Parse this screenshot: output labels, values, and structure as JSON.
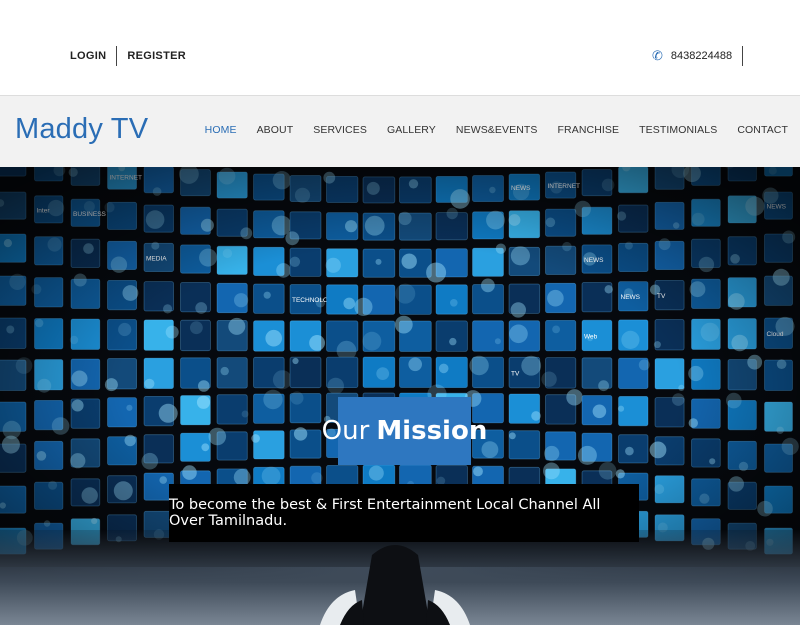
{
  "topbar": {
    "login": "LOGIN",
    "register": "REGISTER",
    "phone": "8438224488"
  },
  "navbar": {
    "brand": "Maddy TV",
    "items": [
      {
        "label": "HOME",
        "active": true
      },
      {
        "label": "ABOUT",
        "active": false
      },
      {
        "label": "SERVICES",
        "active": false
      },
      {
        "label": "GALLERY",
        "active": false
      },
      {
        "label": "NEWS&EVENTS",
        "active": false
      },
      {
        "label": "FRANCHISE",
        "active": false
      },
      {
        "label": "TESTIMONIALS",
        "active": false
      },
      {
        "label": "CONTACT",
        "active": false
      }
    ]
  },
  "hero": {
    "mission_word1": "Our",
    "mission_word2": "Mission",
    "mission_text": "To become the best & First Entertainment Local Channel All Over Tamilnadu.",
    "screen_labels": [
      "INTERNET",
      "NEWS",
      "INTERNET",
      "Inter",
      "BUSINESS",
      "NEWS",
      "MEDIA",
      "NEWS",
      "TECHNOLOGY",
      "NEWS",
      "TV",
      "Web",
      "Cloud",
      "TV"
    ]
  },
  "colors": {
    "accent": "#2a6db5",
    "mission_bg": "#2e77c0",
    "navbar_bg": "#f2f2f2"
  }
}
